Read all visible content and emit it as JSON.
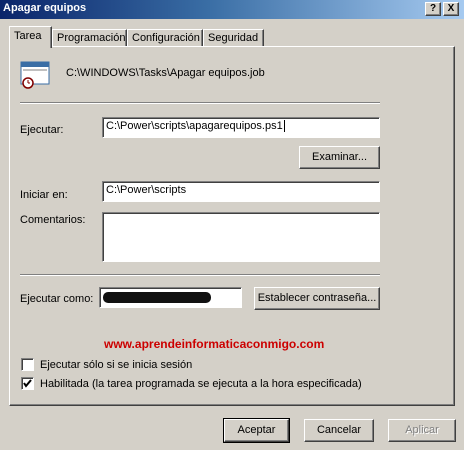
{
  "window": {
    "title": "Apagar equipos",
    "help_glyph": "?",
    "close_glyph": "X"
  },
  "tabs": [
    {
      "label": "Tarea",
      "active": true
    },
    {
      "label": "Programación",
      "active": false
    },
    {
      "label": "Configuración",
      "active": false
    },
    {
      "label": "Seguridad",
      "active": false
    }
  ],
  "task": {
    "icon": "scheduled-task-icon",
    "path": "C:\\WINDOWS\\Tasks\\Apagar equipos.job"
  },
  "ejecutar": {
    "label": "Ejecutar:",
    "value": "C:\\Power\\scripts\\apagarequipos.ps1",
    "browse_label": "Examinar..."
  },
  "iniciar": {
    "label": "Iniciar en:",
    "value": "C:\\Power\\scripts"
  },
  "comentarios": {
    "label": "Comentarios:",
    "value": ""
  },
  "run_as": {
    "label": "Ejecutar como:",
    "password_button": "Establecer contraseña..."
  },
  "watermark": "www.aprendeinformaticaconmigo.com",
  "options": {
    "only_logged_on": {
      "label": "Ejecutar sólo si se inicia sesión",
      "checked": false
    },
    "enabled": {
      "label": "Habilitada (la tarea programada se ejecuta a la hora especificada)",
      "checked": true
    }
  },
  "footer": {
    "ok": "Aceptar",
    "cancel": "Cancelar",
    "apply": "Aplicar"
  },
  "colors": {
    "titlebar_start": "#0a246a",
    "dialog_face": "#d4d0c8",
    "watermark": "#cc0000"
  }
}
